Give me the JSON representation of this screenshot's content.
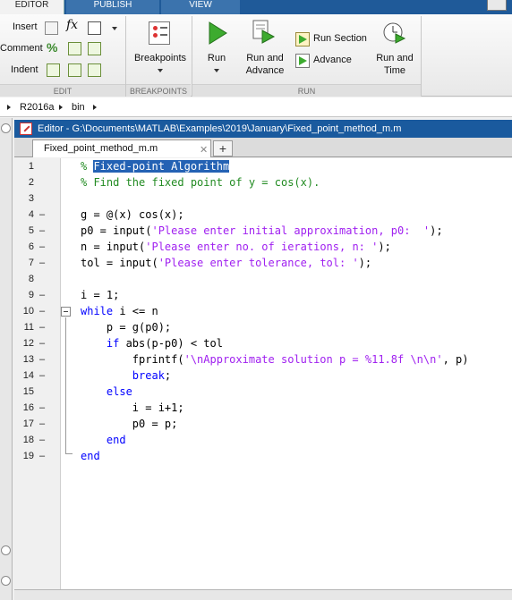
{
  "tabs": [
    "EDITOR",
    "PUBLISH",
    "VIEW"
  ],
  "ribbon": {
    "edit": {
      "insert_label": "Insert",
      "comment_label": "Comment",
      "indent_label": "Indent",
      "fx_label": "fx",
      "section_label": "EDIT"
    },
    "breakpoints": {
      "label": "Breakpoints",
      "section_label": "BREAKPOINTS"
    },
    "run": {
      "run_label": "Run",
      "run_and_advance_label_1": "Run and",
      "run_and_advance_label_2": "Advance",
      "run_section_label": "Run Section",
      "advance_label": "Advance",
      "run_and_time_label_1": "Run and",
      "run_and_time_label_2": "Time",
      "section_label": "RUN"
    }
  },
  "breadcrumb": [
    "R2016a",
    "bin"
  ],
  "editor": {
    "title": "Editor - G:\\Documents\\MATLAB\\Examples\\2019\\January\\Fixed_point_method_m.m",
    "file_tab": "Fixed_point_method_m.m",
    "close_symbol": "✕",
    "add_symbol": "+"
  },
  "code_lines": [
    {
      "n": "1",
      "dash": "",
      "text": "% Fixed-point Algorithm"
    },
    {
      "n": "2",
      "dash": "",
      "text": "% Find the fixed point of y = cos(x)."
    },
    {
      "n": "3",
      "dash": "",
      "text": ""
    },
    {
      "n": "4",
      "dash": "–",
      "text": "g = @(x) cos(x);"
    },
    {
      "n": "5",
      "dash": "–",
      "text": "p0 = input('Please enter initial approximation, p0:  ');"
    },
    {
      "n": "6",
      "dash": "–",
      "text": "n = input('Please enter no. of ierations, n: ');"
    },
    {
      "n": "7",
      "dash": "–",
      "text": "tol = input('Please enter tolerance, tol: ');"
    },
    {
      "n": "8",
      "dash": "",
      "text": ""
    },
    {
      "n": "9",
      "dash": "–",
      "text": "i = 1;"
    },
    {
      "n": "10",
      "dash": "–",
      "text": "while i <= n"
    },
    {
      "n": "11",
      "dash": "–",
      "text": "    p = g(p0);"
    },
    {
      "n": "12",
      "dash": "–",
      "text": "    if abs(p-p0) < tol"
    },
    {
      "n": "13",
      "dash": "–",
      "text": "        fprintf('\\nApproximate solution p = %11.8f \\n\\n', p)"
    },
    {
      "n": "14",
      "dash": "–",
      "text": "        break;"
    },
    {
      "n": "15",
      "dash": "",
      "text": "    else"
    },
    {
      "n": "16",
      "dash": "–",
      "text": "        i = i+1;"
    },
    {
      "n": "17",
      "dash": "–",
      "text": "        p0 = p;"
    },
    {
      "n": "18",
      "dash": "–",
      "text": "    end"
    },
    {
      "n": "19",
      "dash": "–",
      "text": "end"
    }
  ],
  "colors": {
    "comment": "#228b22",
    "keyword": "#0000ff",
    "string": "#a020f0",
    "selection": "#2462b4",
    "title_bar": "#1a5a9e",
    "tab_strip": "#1f5a99"
  }
}
